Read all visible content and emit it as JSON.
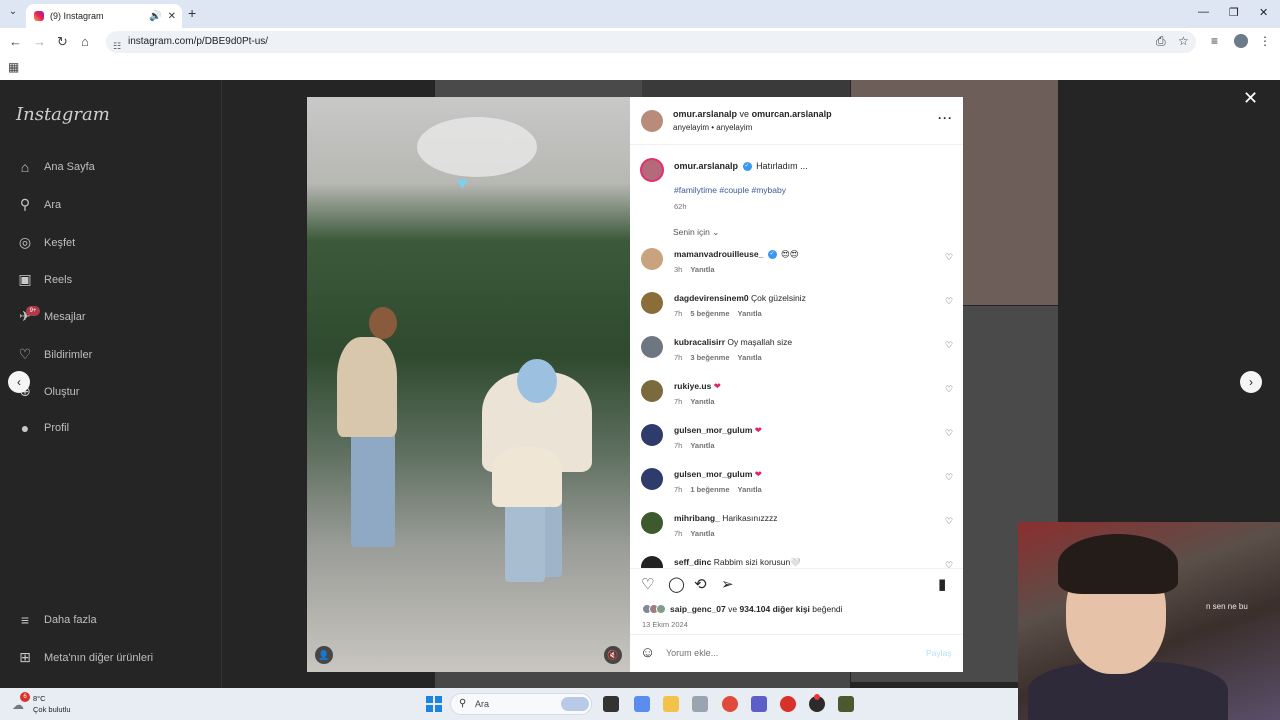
{
  "browser": {
    "tab_title": "(9) Instagram",
    "url": "instagram.com/p/DBE9d0Pt-us/"
  },
  "sidebar": {
    "logo": "Instagram",
    "items": [
      {
        "label": "Ana Sayfa",
        "icon": "home-icon"
      },
      {
        "label": "Ara",
        "icon": "search-icon"
      },
      {
        "label": "Keşfet",
        "icon": "compass-icon"
      },
      {
        "label": "Reels",
        "icon": "reels-icon"
      },
      {
        "label": "Mesajlar",
        "icon": "messenger-icon"
      },
      {
        "label": "Bildirimler",
        "icon": "heart-icon"
      },
      {
        "label": "Oluştur",
        "icon": "plus-icon"
      },
      {
        "label": "Profil",
        "icon": "avatar-icon"
      }
    ],
    "messages_badge": "9+",
    "more": "Daha fazla",
    "meta": "Meta'nın diğer ürünleri"
  },
  "post": {
    "header_user1": "omur.arslanalp",
    "header_and": "ve",
    "header_user2": "omurcan.arslanalp",
    "header_audio": "anyelayim • anyelayim",
    "caption_user": "omur.arslanalp",
    "caption_text": "Hatırladım ...",
    "hashtags": "#familytime #couple #mybaby",
    "caption_time": "62h",
    "filter_label": "Senin için",
    "comments": [
      {
        "user": "mamanvadrouilleuse_",
        "verified": true,
        "text": "😍😍",
        "time": "3h",
        "likes": "",
        "reply": "Yanıtla"
      },
      {
        "user": "dagdevirensinem0",
        "verified": false,
        "text": "Çok güzelsiniz",
        "time": "7h",
        "likes": "5 beğenme",
        "reply": "Yanıtla"
      },
      {
        "user": "kubracalisirr",
        "verified": false,
        "text": "Oy maşallah size",
        "time": "7h",
        "likes": "3 beğenme",
        "reply": "Yanıtla"
      },
      {
        "user": "rukiye.us",
        "verified": false,
        "text": "❤",
        "time": "7h",
        "likes": "",
        "reply": "Yanıtla"
      },
      {
        "user": "gulsen_mor_gulum",
        "verified": false,
        "text": "❤",
        "time": "7h",
        "likes": "",
        "reply": "Yanıtla"
      },
      {
        "user": "gulsen_mor_gulum",
        "verified": false,
        "text": "❤",
        "time": "7h",
        "likes": "1 beğenme",
        "reply": "Yanıtla"
      },
      {
        "user": "mihribang_",
        "verified": false,
        "text": "Harikasınızzzz",
        "time": "7h",
        "likes": "",
        "reply": "Yanıtla"
      },
      {
        "user": "seff_dinc",
        "verified": false,
        "text": "Rabbim sizi korusun🤍",
        "time": "",
        "likes": "",
        "reply": ""
      }
    ],
    "likes_user": "saip_genc_07",
    "likes_and": "ve",
    "likes_count": "934.104 diğer kişi",
    "likes_suffix": "beğendi",
    "date": "13 Ekim 2024",
    "comment_placeholder": "Yorum ekle...",
    "share_label": "Paylaş"
  },
  "webcam": {
    "overlay_text": "n sen ne bu"
  },
  "taskbar": {
    "temp": "8°C",
    "weather": "Çok bulutlu",
    "weather_badge": "6",
    "search_label": "Ara"
  },
  "colors": {
    "instagram_link": "#3d5a98",
    "verified": "#3897f0",
    "share_disabled": "#b2dffc",
    "windows_accent": "#1b84e3"
  }
}
